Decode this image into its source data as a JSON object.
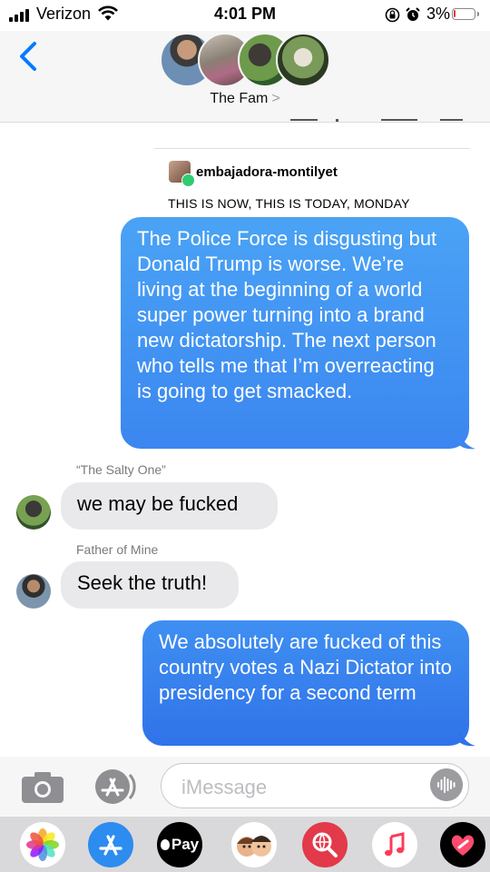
{
  "status_bar": {
    "carrier": "Verizon",
    "time": "4:01 PM",
    "battery_pct": "3%",
    "battery_level": 0.03,
    "icons": [
      "signal-bars-icon",
      "wifi-icon",
      "rotation-lock-icon",
      "alarm-icon",
      "battery-icon"
    ]
  },
  "header": {
    "group_name": "The Fam",
    "chevron": ">",
    "back_icon": "back-chevron-icon",
    "participant_avatars": 4
  },
  "shared_post": {
    "username": "embajadora-montilyet",
    "caption": "THIS IS NOW, THIS IS TODAY, MONDAY"
  },
  "messages": [
    {
      "direction": "sent",
      "text": "The Police Force is disgusting but Donald Trump is worse. We’re living at the beginning of a world super power turning into a brand new dictatorship. The next person who tells me that I’m overreacting is going to get smacked."
    },
    {
      "direction": "received",
      "sender": "“The Salty One”",
      "text": "we may be fucked"
    },
    {
      "direction": "received",
      "sender": "Father of Mine",
      "text": "Seek the truth!"
    },
    {
      "direction": "sent",
      "text": "We absolutely are fucked of this country votes a Nazi Dictator into presidency for a second term"
    }
  ],
  "input": {
    "placeholder": "iMessage",
    "camera_icon": "camera-icon",
    "apps_icon": "app-store-icon",
    "audio_icon": "audio-waveform-icon"
  },
  "app_drawer": {
    "apple_pay_label": "Pay",
    "apps": [
      "photos-icon",
      "app-store-icon",
      "apple-pay-icon",
      "memoji-icon",
      "web-search-icon",
      "music-icon",
      "heart-app-icon"
    ]
  },
  "colors": {
    "sent_bubble": "#3b86f0",
    "received_bubble": "#e9e9eb",
    "ios_blue": "#007aff",
    "header_bg": "#f6f6f6"
  }
}
